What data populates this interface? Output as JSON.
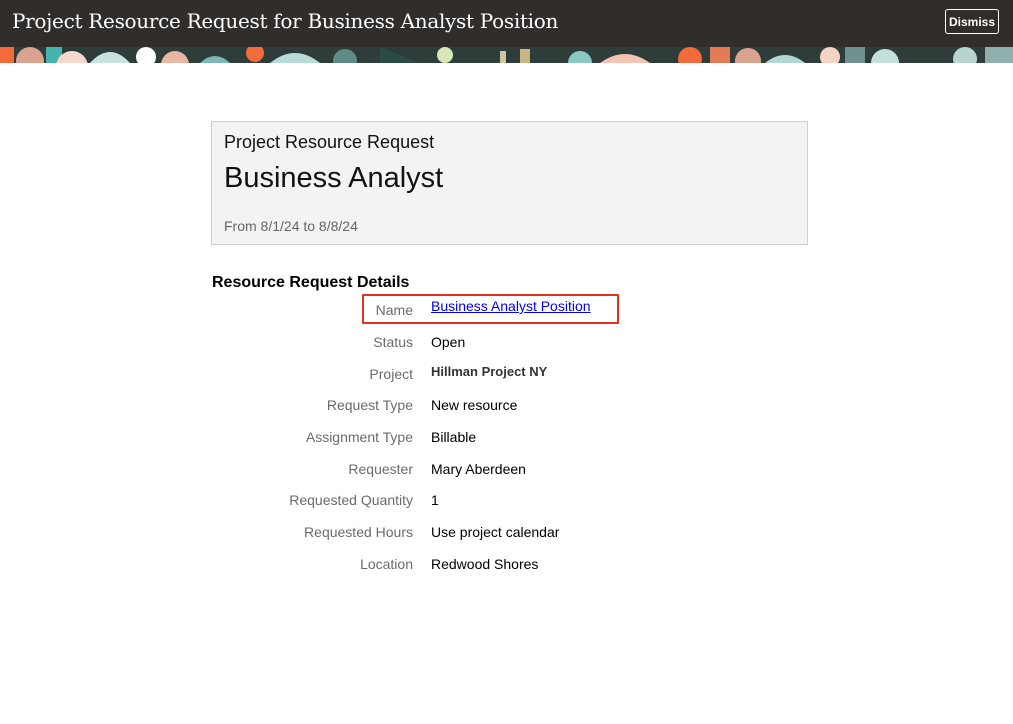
{
  "header": {
    "title": "Project Resource Request for Business Analyst Position",
    "dismiss_label": "Dismiss",
    "background_color": "#312d2a"
  },
  "summary_card": {
    "subtitle": "Project Resource Request",
    "title": "Business Analyst",
    "dates": "From 8/1/24 to 8/8/24"
  },
  "details": {
    "heading": "Resource Request Details",
    "name": {
      "label": "Name",
      "value": "Business Analyst Position"
    },
    "status": {
      "label": "Status",
      "value": "Open"
    },
    "project": {
      "label": "Project",
      "value": "Hillman Project NY"
    },
    "request_type": {
      "label": "Request Type",
      "value": "New resource"
    },
    "assignment_type": {
      "label": "Assignment Type",
      "value": "Billable"
    },
    "requester": {
      "label": "Requester",
      "value": "Mary Aberdeen"
    },
    "requested_quantity": {
      "label": "Requested Quantity",
      "value": "1"
    },
    "requested_hours": {
      "label": "Requested Hours",
      "value": "Use project calendar"
    },
    "location": {
      "label": "Location",
      "value": "Redwood Shores"
    }
  },
  "colors": {
    "link": "#0000ee",
    "highlight": "#e0321f",
    "label": "#6b6b6b"
  }
}
